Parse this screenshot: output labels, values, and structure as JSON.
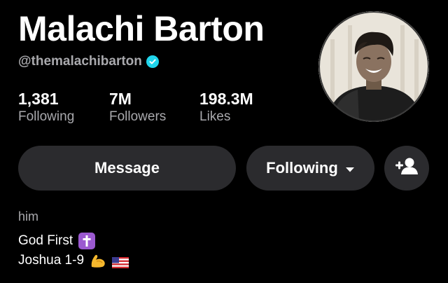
{
  "profile": {
    "name": "Malachi Barton",
    "handle": "@themalachibarton",
    "verified": true
  },
  "stats": [
    {
      "value": "1,381",
      "label": "Following"
    },
    {
      "value": "7M",
      "label": "Followers"
    },
    {
      "value": "198.3M",
      "label": "Likes"
    }
  ],
  "actions": {
    "message_label": "Message",
    "following_label": "Following",
    "add_friend_icon": "add-friend-icon"
  },
  "bio": {
    "pronoun": "him",
    "line1": "God First",
    "line2": "Joshua 1-9"
  },
  "colors": {
    "background": "#000000",
    "button": "#2b2b2e",
    "muted_text": "#a9a9ad",
    "verified": "#20d5ec"
  }
}
